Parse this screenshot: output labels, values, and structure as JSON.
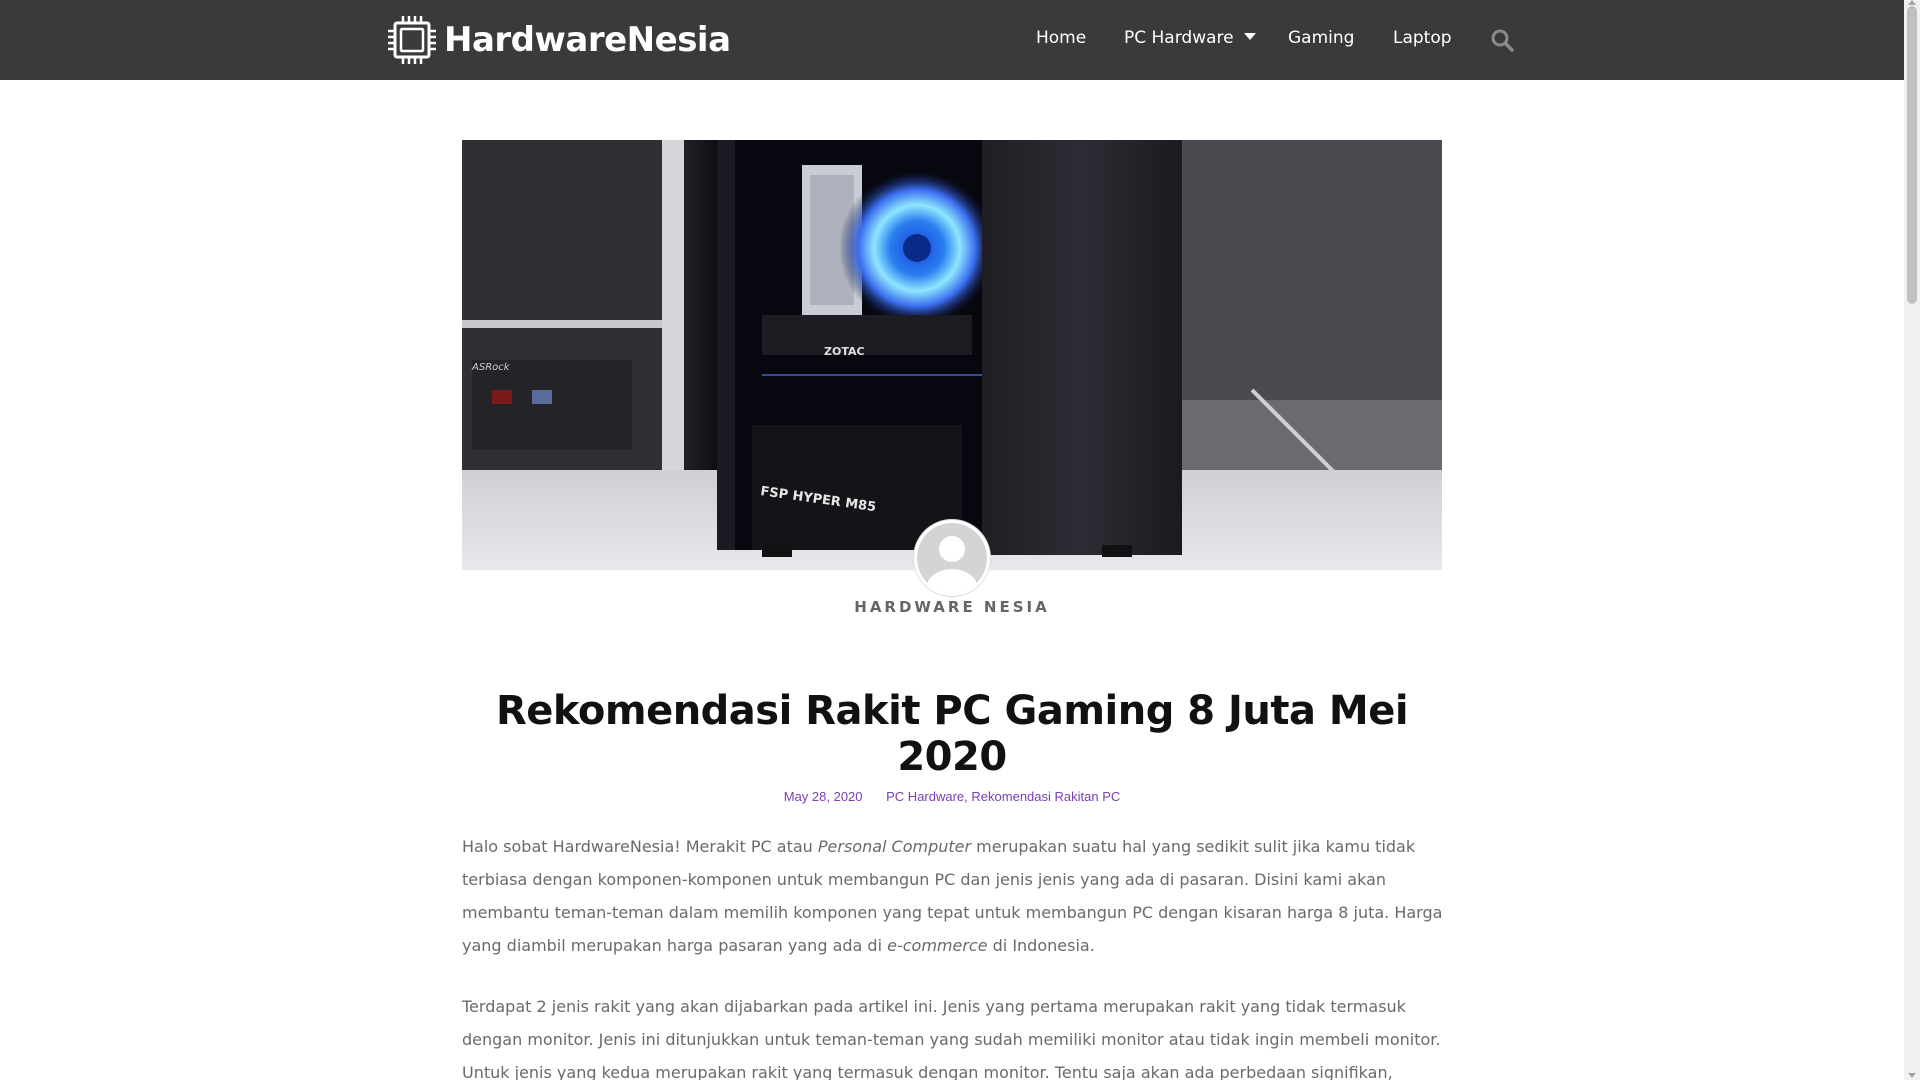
{
  "site": {
    "logo_text": "HardwareNesia"
  },
  "nav": {
    "items": [
      {
        "label": "Home"
      },
      {
        "label": "PC Hardware"
      },
      {
        "label": "Gaming"
      },
      {
        "label": "Laptop"
      }
    ]
  },
  "colors": {
    "header_bg": "#3a3a3a",
    "accent": "#7a3fb0"
  },
  "hero": {
    "case_text": "FSP HYPER M85",
    "gpu_text": "ZOTAC",
    "board_text": "ASRock"
  },
  "post": {
    "author": "HARDWARE NESIA",
    "title": "Rekomendasi Rakit PC Gaming 8 Juta Mei 2020",
    "date": "May 28, 2020",
    "category_1": "PC Hardware",
    "category_sep": ", ",
    "category_2": "Rekomendasi Rakitan PC",
    "p1": {
      "a": "Halo sobat HardwareNesia! Merakit PC atau ",
      "a_em": "Personal Computer",
      "b": " merupakan suatu hal yang sedikit sulit jika kamu tidak terbiasa dengan komponen-komponen untuk membangun PC dan jenis jenis yang ada di pasaran. Disini kami akan membantu teman-teman dalam memilih komponen yang tepat untuk membangun PC dengan kisaran harga 8 juta. Harga yang diambil merupakan harga pasaran yang ada di ",
      "b_em": "e-commerce",
      "c": " di Indonesia."
    },
    "p2": "Terdapat 2 jenis rakit yang akan dijabarkan pada artikel ini. Jenis yang pertama merupakan rakit yang tidak termasuk dengan monitor. Jenis ini ditunjukkan untuk teman-teman yang sudah memiliki monitor atau tidak ingin membeli monitor. Untuk jenis yang kedua merupakan rakit yang termasuk dengan monitor. Tentu saja akan ada perbedaan signifikan, karena dengan memasukkan"
  }
}
